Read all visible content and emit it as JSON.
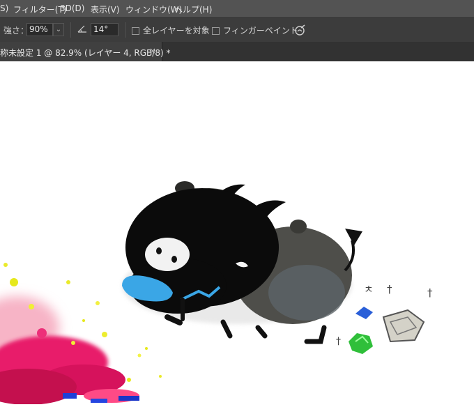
{
  "menu": {
    "items": [
      "S)",
      "フィルター(T)",
      "3D(D)",
      "表示(V)",
      "ウィンドウ(W)",
      "ヘルプ(H)"
    ]
  },
  "options": {
    "strength_label": "強さ：",
    "strength_value": "90%",
    "angle_icon": "angle-icon",
    "angle_value": "14°",
    "sample_all_layers_label": "全レイヤーを対象",
    "sample_all_layers_checked": false,
    "finger_painting_label": "フィンガーペイント",
    "finger_painting_checked": false,
    "pressure_icon": "pressure-icon"
  },
  "document_tab": {
    "title": "称未設定 1 @ 82.9% (レイヤー 4, RGB/8) *",
    "close_label": "×"
  },
  "canvas": {
    "annotation_marks": [
      "ㅊ",
      "†",
      "†",
      "†"
    ],
    "colors": {
      "menubar": "#535353",
      "optionsbar": "#3c3c3c",
      "tabbar": "#323232",
      "creature_body": "#0b0b0b",
      "tongue": "#3aa6e6",
      "blue_gem": "#2a5fd8",
      "green_gem": "#2fbf3a"
    }
  }
}
